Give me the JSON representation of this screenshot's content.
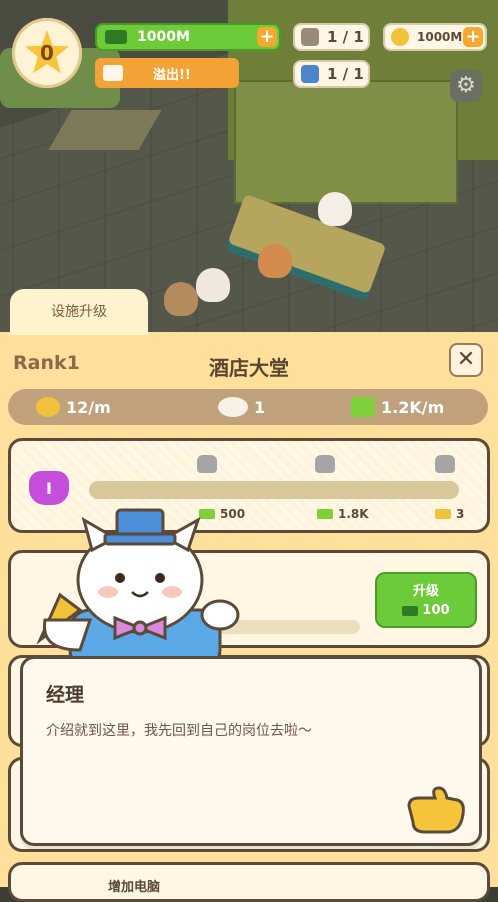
{
  "hud": {
    "level": "0",
    "money": "1000M",
    "overflow_label": "溢出!!",
    "hammer_count": "1 / 1",
    "potion_count": "1 / 1",
    "fish_amount": "1000M"
  },
  "panel": {
    "tab_label": "设施升级",
    "rank": "Rank1",
    "title": "酒店大堂",
    "stats": {
      "time_rate": "12/m",
      "cats": "1",
      "income_rate": "1.2K/m"
    }
  },
  "level_card": {
    "level": "I",
    "rewards": [
      "500",
      "1.8K",
      "3"
    ]
  },
  "upgrade_card": {
    "button_label": "升级",
    "cost": "100"
  },
  "dialog": {
    "speaker": "经理",
    "text": "介绍就到这里，我先回到自己的岗位去啦～"
  },
  "peek": {
    "text": "增加电脑"
  },
  "colors": {
    "panel_bg": "#ffe09b",
    "green_button": "#6dcb3a",
    "orange_button": "#f3a235",
    "stats_bar": "#bfa27c"
  }
}
